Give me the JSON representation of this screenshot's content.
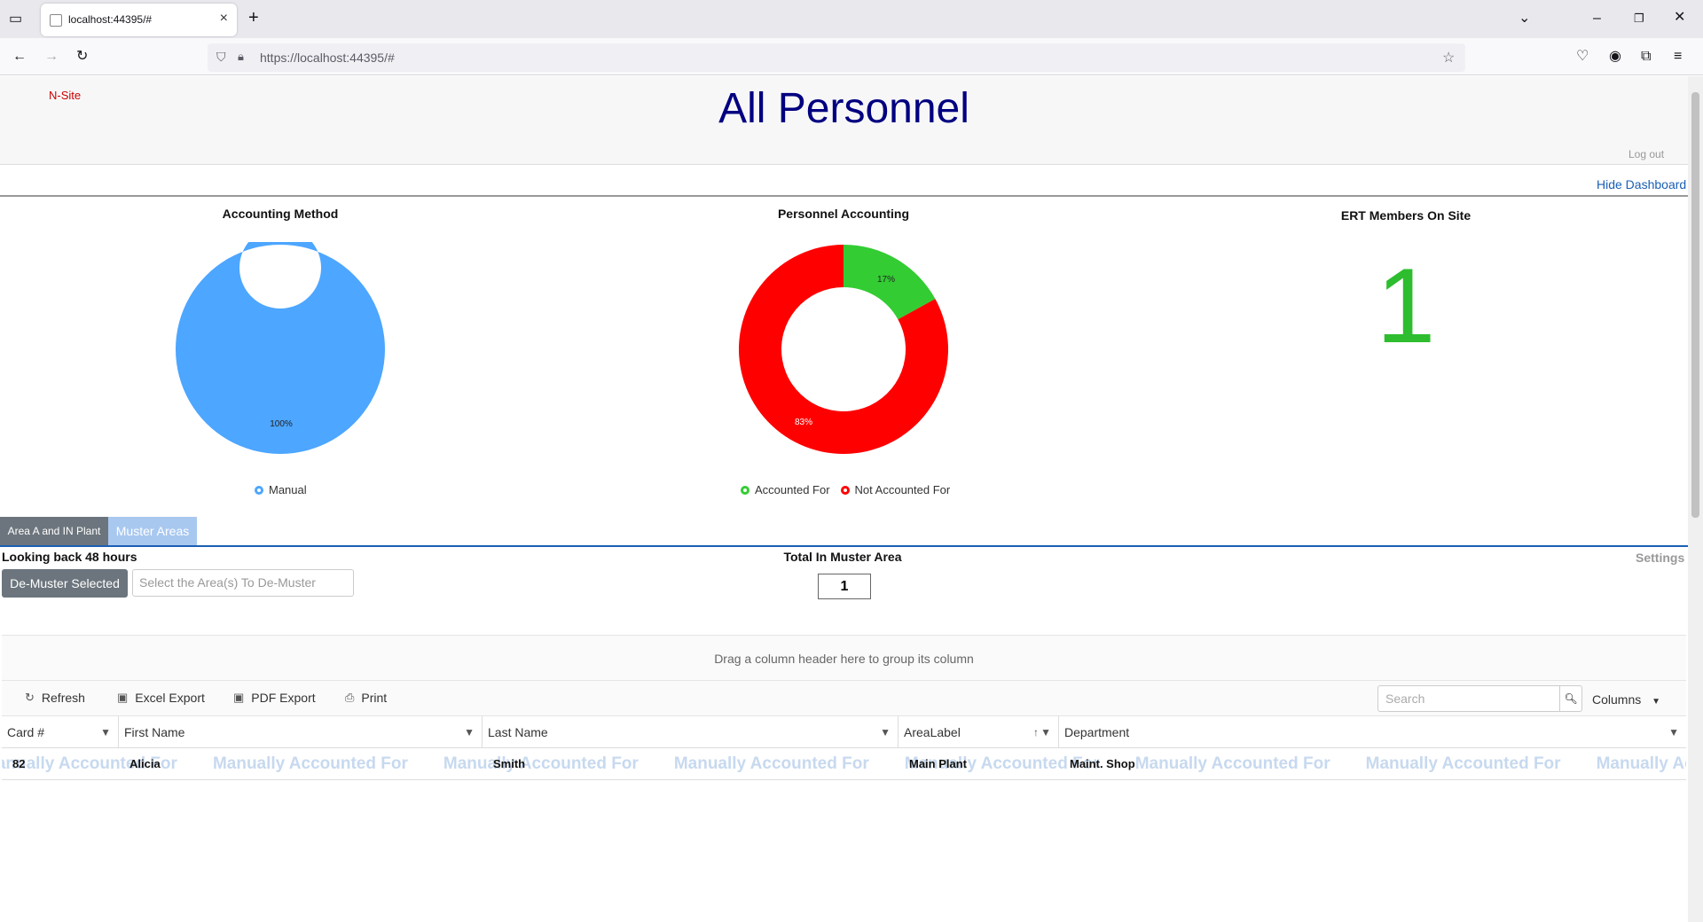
{
  "browser": {
    "tab_title": "localhost:44395/#",
    "url": "https://localhost:44395/#",
    "tab_close": "×",
    "new_tab": "+"
  },
  "header": {
    "site": "N-Site",
    "title": "All Personnel",
    "logout": "Log out",
    "hide_dashboard": "Hide Dashboard"
  },
  "dashboard": {
    "accounting_method": {
      "title": "Accounting Method",
      "legend": [
        "Manual"
      ],
      "slices": [
        {
          "label": "Manual",
          "value": 100,
          "color": "#4da6ff",
          "pct_label": "100%"
        }
      ]
    },
    "personnel_accounting": {
      "title": "Personnel Accounting",
      "legend": [
        "Accounted For",
        "Not Accounted For"
      ],
      "slices": [
        {
          "label": "Accounted For",
          "value": 17,
          "color": "#33cc33",
          "pct_label": "17%"
        },
        {
          "label": "Not Accounted For",
          "value": 83,
          "color": "#ff0000",
          "pct_label": "83%"
        }
      ]
    },
    "ert": {
      "title": "ERT Members On Site",
      "value": "1",
      "color": "#2ebd2e"
    }
  },
  "tabs": [
    "Area A and IN Plant",
    "Muster Areas"
  ],
  "muster": {
    "lookback": "Looking back 48 hours",
    "demuster_button": "De-Muster Selected",
    "area_placeholder": "Select the Area(s) To De-Muster",
    "total_label": "Total In Muster Area",
    "total_value": "1",
    "settings": "Settings"
  },
  "grid": {
    "group_hint": "Drag a column header here to group its column",
    "toolbar": {
      "refresh": "Refresh",
      "excel": "Excel Export",
      "pdf": "PDF Export",
      "print": "Print",
      "search_placeholder": "Search",
      "columns": "Columns"
    },
    "columns": [
      "Card #",
      "First Name",
      "Last Name",
      "AreaLabel",
      "Department"
    ],
    "rows": [
      {
        "card": "82",
        "first": "Alicia",
        "last": "Smith",
        "area": "Main Plant",
        "dept": "Maint. Shop",
        "status": "Manually Accounted For"
      }
    ]
  }
}
